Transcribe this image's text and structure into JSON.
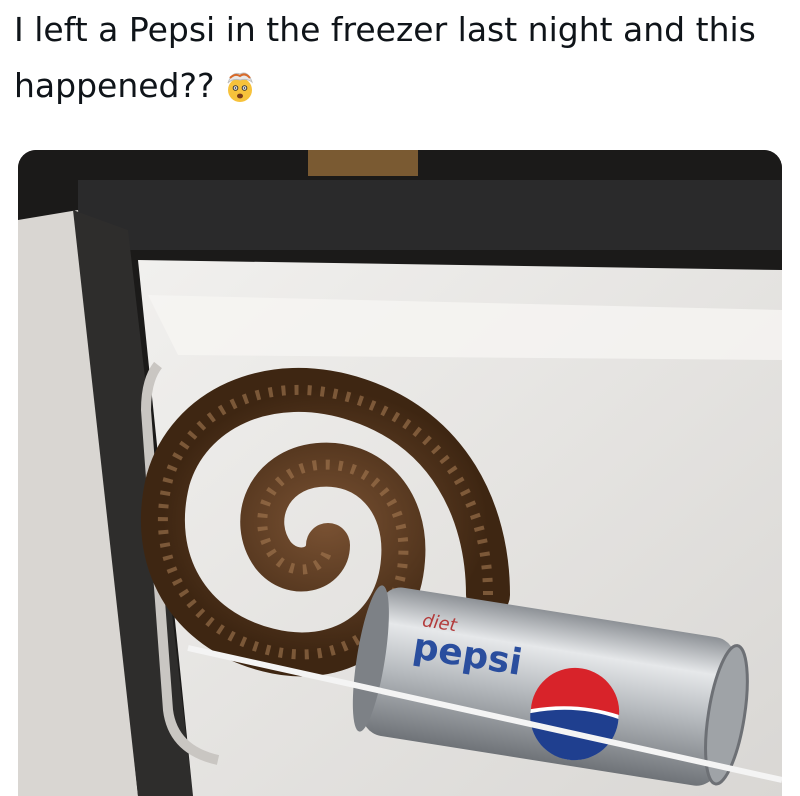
{
  "post": {
    "caption": "I left a Pepsi in the freezer last night and this happened??",
    "emoji": "exploding-head-emoji"
  },
  "photo": {
    "can_brand_top": "diet",
    "can_brand_main": "pepsi"
  },
  "colors": {
    "freezer_white": "#e9e7e4",
    "cola_brown": "#5a3a22",
    "can_silver": "#b9bcc0",
    "pepsi_red": "#d8232a",
    "pepsi_blue": "#1f3f8f"
  }
}
